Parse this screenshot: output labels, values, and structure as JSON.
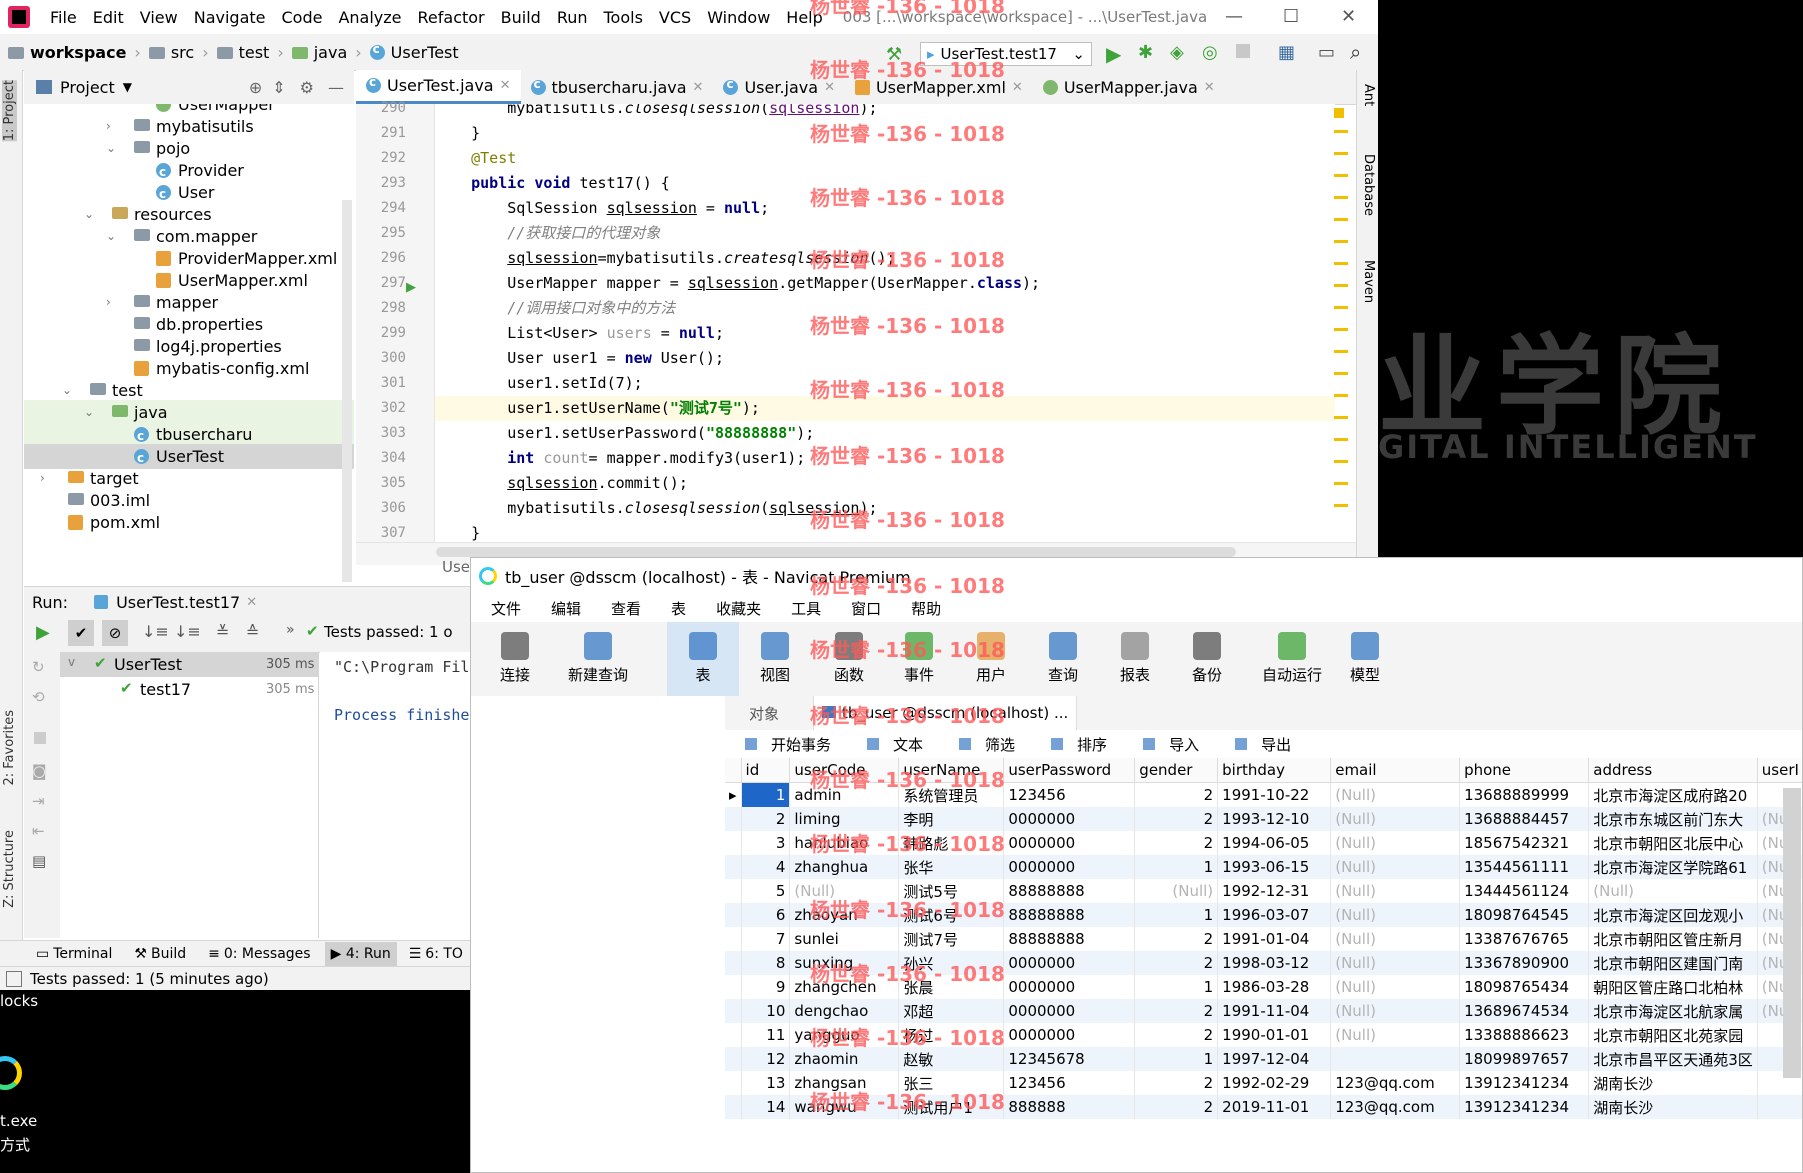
{
  "ide": {
    "menu": [
      "File",
      "Edit",
      "View",
      "Navigate",
      "Code",
      "Analyze",
      "Refactor",
      "Build",
      "Run",
      "Tools",
      "VCS",
      "Window",
      "Help"
    ],
    "window_title": "003 [...\\workspace\\workspace] - ...\\UserTest.java",
    "breadcrumb": [
      "workspace",
      "src",
      "test",
      "java",
      "UserTest"
    ],
    "run_config": "UserTest.test17",
    "project_label": "Project",
    "left_tabs": [
      "1: Project",
      "2: Favorites",
      "Z: Structure"
    ],
    "right_tabs": [
      "Ant",
      "Database",
      "Maven"
    ],
    "tree": [
      {
        "label": "UserMapper",
        "indent": 3,
        "icon": "interface",
        "arrow": ""
      },
      {
        "label": "mybatisutils",
        "indent": 2,
        "icon": "folder",
        "arrow": ">"
      },
      {
        "label": "pojo",
        "indent": 2,
        "icon": "folder",
        "arrow": "v"
      },
      {
        "label": "Provider",
        "indent": 3,
        "icon": "class",
        "arrow": ""
      },
      {
        "label": "User",
        "indent": 3,
        "icon": "class",
        "arrow": ""
      },
      {
        "label": "resources",
        "indent": 1,
        "icon": "res",
        "arrow": "v"
      },
      {
        "label": "com.mapper",
        "indent": 2,
        "icon": "folder",
        "arrow": "v"
      },
      {
        "label": "ProviderMapper.xml",
        "indent": 3,
        "icon": "xml",
        "arrow": ""
      },
      {
        "label": "UserMapper.xml",
        "indent": 3,
        "icon": "xml",
        "arrow": ""
      },
      {
        "label": "mapper",
        "indent": 2,
        "icon": "folder",
        "arrow": ">"
      },
      {
        "label": "db.properties",
        "indent": 2,
        "icon": "file",
        "arrow": ""
      },
      {
        "label": "log4j.properties",
        "indent": 2,
        "icon": "file",
        "arrow": ""
      },
      {
        "label": "mybatis-config.xml",
        "indent": 2,
        "icon": "xml",
        "arrow": ""
      },
      {
        "label": "test",
        "indent": 0,
        "icon": "folder",
        "arrow": "v"
      },
      {
        "label": "java",
        "indent": 1,
        "icon": "java",
        "arrow": "v"
      },
      {
        "label": "tbusercharu",
        "indent": 2,
        "icon": "class",
        "arrow": ""
      },
      {
        "label": "UserTest",
        "indent": 2,
        "icon": "class",
        "arrow": ""
      },
      {
        "label": "target",
        "indent": -1,
        "icon": "orange",
        "arrow": ">"
      },
      {
        "label": "003.iml",
        "indent": -1,
        "icon": "file",
        "arrow": ""
      },
      {
        "label": "pom.xml",
        "indent": -1,
        "icon": "xml",
        "arrow": ""
      }
    ],
    "tabs": [
      {
        "label": "UserTest.java",
        "active": true,
        "icon": "class"
      },
      {
        "label": "tbusercharu.java",
        "active": false,
        "icon": "class"
      },
      {
        "label": "User.java",
        "active": false,
        "icon": "class"
      },
      {
        "label": "UserMapper.xml",
        "active": false,
        "icon": "xml"
      },
      {
        "label": "UserMapper.java",
        "active": false,
        "icon": "interface"
      }
    ],
    "code_lines": [
      {
        "n": "290",
        "html": "        mybatisutils.<span class='it'>closesqlsession</span>(<span class='un fld'>sqlsession</span>);"
      },
      {
        "n": "291",
        "html": "    }"
      },
      {
        "n": "292",
        "html": "    <span class='an'>@Test</span>"
      },
      {
        "n": "293",
        "html": "    <span class='kw'>public void</span> test17() {"
      },
      {
        "n": "294",
        "html": "        SqlSession <span class='un'>sqlsession</span> = <span class='kw'>null</span>;"
      },
      {
        "n": "295",
        "html": "        <span class='cm'>//获取接口的代理对象</span>"
      },
      {
        "n": "296",
        "html": "        <span class='un'>sqlsession</span>=mybatisutils.<span class='it'>createsqlsession</span>();"
      },
      {
        "n": "297",
        "html": "        UserMapper mapper = <span class='un'>sqlsession</span>.getMapper(UserMapper.<span class='kw'>class</span>);"
      },
      {
        "n": "298",
        "html": "        <span class='cm'>//调用接口对象中的方法</span>"
      },
      {
        "n": "299",
        "html": "        List&lt;User&gt; <span class='gr'>users</span> = <span class='kw'>null</span>;"
      },
      {
        "n": "300",
        "html": "        User user1 = <span class='kw'>new</span> User();"
      },
      {
        "n": "301",
        "html": "        user1.setId(7);"
      },
      {
        "n": "302",
        "html": "        user1.setUserName(<span class='st'>\"测试7号\"</span>);"
      },
      {
        "n": "303",
        "html": "        user1.setUserPassword(<span class='st'>\"88888888\"</span>);"
      },
      {
        "n": "304",
        "html": "        <span class='kw'>int</span> <span class='gr'>count</span>= mapper.modify3(user1);"
      },
      {
        "n": "305",
        "html": "        <span class='un'>sqlsession</span>.commit();"
      },
      {
        "n": "306",
        "html": "        mybatisutils.<span class='it'>closesqlsession</span>(<span class='un'>sqlsession</span>);"
      },
      {
        "n": "307",
        "html": "    }"
      }
    ],
    "editor_bottom_label": "Use",
    "run_label": "Run:",
    "run_tab": "UserTest.test17",
    "tests_passed": "Tests passed: 1 o",
    "run_tree": [
      {
        "label": "UserTest",
        "time": "305 ms"
      },
      {
        "label": "test17",
        "time": "305 ms"
      }
    ],
    "run_output": [
      "\"C:\\Program Fil",
      "Process finishe"
    ],
    "bottom_tabs": [
      "Terminal",
      "Build",
      "0: Messages",
      "4: Run",
      "6: TO"
    ],
    "status": "Tests passed: 1 (5 minutes ago)"
  },
  "desktop": {
    "text_lines": [
      "locks",
      "t.exe",
      "方式"
    ],
    "bg_text_1": "业学院",
    "bg_text_2": "GITAL INTELLIGENT"
  },
  "navicat": {
    "title": "tb_user @dsscm (localhost) - 表 - Navicat Premium",
    "menu": [
      "文件",
      "编辑",
      "查看",
      "表",
      "收藏夹",
      "工具",
      "窗口",
      "帮助"
    ],
    "toolbar": [
      "连接",
      "新建查询",
      "表",
      "视图",
      "函数",
      "事件",
      "用户",
      "查询",
      "报表",
      "备份",
      "自动运行",
      "模型"
    ],
    "object_tab": "对象",
    "table_tab": "tb_user @dsscm (localhost) ...",
    "actions": [
      "开始事务",
      "文本",
      "筛选",
      "排序",
      "导入",
      "导出"
    ],
    "columns": [
      "id",
      "userCode",
      "userName",
      "userPassword",
      "gender",
      "birthday",
      "email",
      "phone",
      "address",
      "userI"
    ],
    "rows": [
      [
        "1",
        "admin",
        "系统管理员",
        "123456",
        "2",
        "1991-10-22",
        "(Null)",
        "13688889999",
        "北京市海淀区成府路20",
        ""
      ],
      [
        "2",
        "liming",
        "李明",
        "0000000",
        "2",
        "1993-12-10",
        "(Null)",
        "13688884457",
        "北京市东城区前门东大",
        "(Null"
      ],
      [
        "3",
        "hanlubiao",
        "韩路彪",
        "0000000",
        "2",
        "1994-06-05",
        "(Null)",
        "18567542321",
        "北京市朝阳区北辰中心",
        "(Null"
      ],
      [
        "4",
        "zhanghua",
        "张华",
        "0000000",
        "1",
        "1993-06-15",
        "(Null)",
        "13544561111",
        "北京市海淀区学院路61",
        "(Null"
      ],
      [
        "5",
        "(Null)",
        "测试5号",
        "88888888",
        "(Null)",
        "1992-12-31",
        "(Null)",
        "13444561124",
        "(Null)",
        "(Null"
      ],
      [
        "6",
        "zhaoyan",
        "测试6号",
        "88888888",
        "1",
        "1996-03-07",
        "(Null)",
        "18098764545",
        "北京市海淀区回龙观小",
        "(Null"
      ],
      [
        "7",
        "sunlei",
        "测试7号",
        "88888888",
        "2",
        "1991-01-04",
        "(Null)",
        "13387676765",
        "北京市朝阳区管庄新月",
        "(Null"
      ],
      [
        "8",
        "sunxing",
        "孙兴",
        "0000000",
        "2",
        "1998-03-12",
        "(Null)",
        "13367890900",
        "北京市朝阳区建国门南",
        "(Null"
      ],
      [
        "9",
        "zhangchen",
        "张晨",
        "0000000",
        "1",
        "1986-03-28",
        "(Null)",
        "18098765434",
        "朝阳区管庄路口北柏林",
        "(Null"
      ],
      [
        "10",
        "dengchao",
        "邓超",
        "0000000",
        "2",
        "1991-11-04",
        "(Null)",
        "13689674534",
        "北京市海淀区北航家属",
        "(Null"
      ],
      [
        "11",
        "yangguo",
        "杨过",
        "0000000",
        "2",
        "1990-01-01",
        "(Null)",
        "13388886623",
        "北京市朝阳区北苑家园",
        ""
      ],
      [
        "12",
        "zhaomin",
        "赵敏",
        "12345678",
        "1",
        "1997-12-04",
        "",
        "18099897657",
        "北京市昌平区天通苑3区",
        ""
      ],
      [
        "13",
        "zhangsan",
        "张三",
        "123456",
        "2",
        "1992-02-29",
        "123@qq.com",
        "13912341234",
        "湖南长沙",
        ""
      ],
      [
        "14",
        "wangwu",
        "测试用户1",
        "888888",
        "2",
        "2019-11-01",
        "123@qq.com",
        "13912341234",
        "湖南长沙",
        ""
      ]
    ]
  },
  "watermark": "杨世睿 -136 - 1018"
}
